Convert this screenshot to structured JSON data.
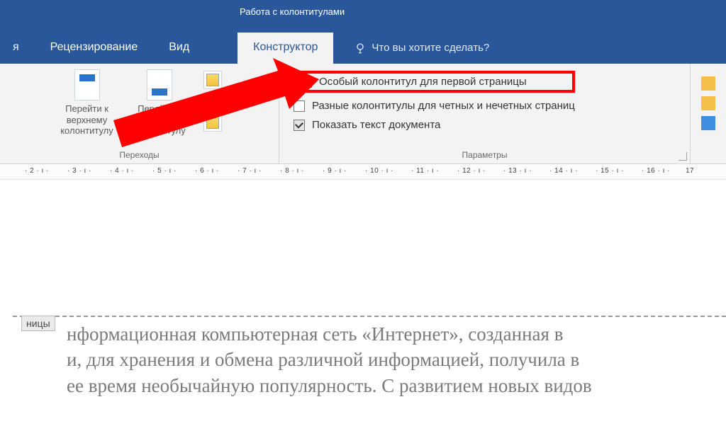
{
  "titlebar": {
    "context_title": "Работа с колонтитулами"
  },
  "tabs": {
    "t1": "Рецензирование",
    "t2": "Вид",
    "active": "Конструктор",
    "tellme": "Что вы хотите сделать?"
  },
  "ribbon": {
    "transition": {
      "label": "Переходы",
      "go_header": "Перейти к верхнему колонтитулу",
      "go_footer": "Перейти к нижнему колонтитулу"
    },
    "params": {
      "label": "Параметры",
      "opt1": "Особый колонтитул для первой страницы",
      "opt2": "Разные колонтитулы для четных и нечетных страниц",
      "opt3": "Показать текст документа"
    }
  },
  "ruler": {
    "marks": [
      "2",
      "3",
      "4",
      "5",
      "6",
      "7",
      "8",
      "9",
      "10",
      "11",
      "12",
      "13",
      "14",
      "15",
      "16",
      "17"
    ]
  },
  "document": {
    "header_tag": "ницы",
    "line1": "нформационная компьютерная сеть «Интернет», созданная в",
    "line2": "и, для хранения и обмена различной информацией, получила в",
    "line3": "ее время необычайную популярность. С развитием новых видов"
  }
}
